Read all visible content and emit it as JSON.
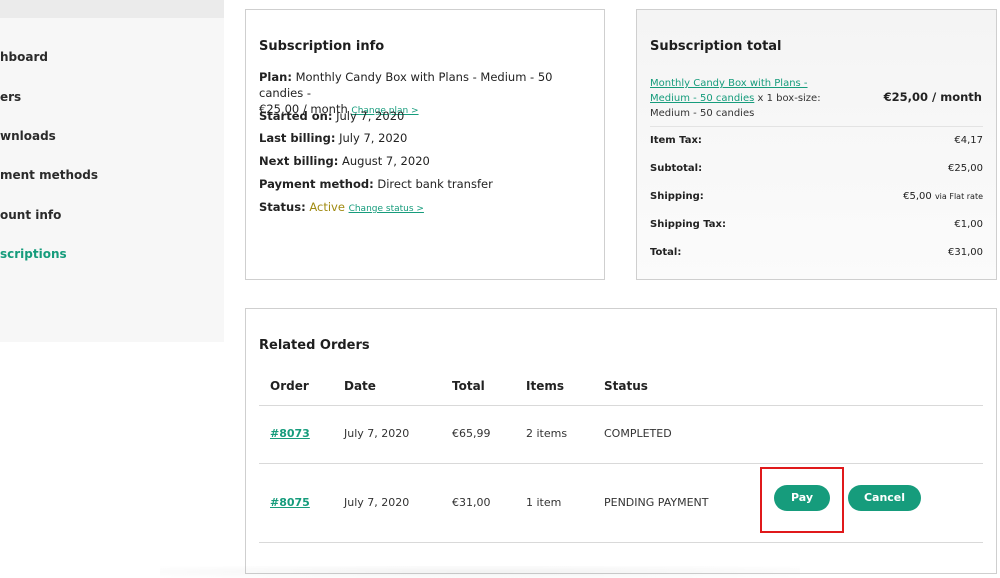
{
  "sidebar": {
    "items": [
      {
        "label": "hboard"
      },
      {
        "label": "ers"
      },
      {
        "label": "wnloads"
      },
      {
        "label": "ment methods"
      },
      {
        "label": "ount info"
      },
      {
        "label": "scriptions"
      }
    ]
  },
  "subscription_info": {
    "title": "Subscription info",
    "plan_label": "Plan:",
    "plan_value": "Monthly Candy Box with Plans - Medium - 50 candies -",
    "plan_price": "€25,00 / month",
    "change_plan": "Change plan >",
    "started_label": "Started on:",
    "started_value": "July 7, 2020",
    "last_billing_label": "Last billing:",
    "last_billing_value": "July 7, 2020",
    "next_billing_label": "Next billing:",
    "next_billing_value": "August 7, 2020",
    "payment_method_label": "Payment method:",
    "payment_method_value": "Direct bank transfer",
    "status_label": "Status:",
    "status_value": "Active",
    "change_status": "Change status >"
  },
  "subscription_total": {
    "title": "Subscription total",
    "product_link_line1": "Monthly Candy Box with Plans -",
    "product_link_line2": "Medium - 50 candies",
    "product_qty": "x 1 box-size:",
    "product_variant": "Medium - 50 candies",
    "product_price": "€25,00 / month",
    "rows": [
      {
        "label": "Item Tax:",
        "value": "€4,17"
      },
      {
        "label": "Subtotal:",
        "value": "€25,00"
      },
      {
        "label": "Shipping:",
        "value": "€5,00",
        "suffix": "via Flat rate"
      },
      {
        "label": "Shipping Tax:",
        "value": "€1,00"
      },
      {
        "label": "Total:",
        "value": "€31,00"
      }
    ]
  },
  "related_orders": {
    "title": "Related Orders",
    "headers": {
      "order": "Order",
      "date": "Date",
      "total": "Total",
      "items": "Items",
      "status": "Status"
    },
    "rows": [
      {
        "order": "#8073",
        "date": "July 7, 2020",
        "total": "€65,99",
        "items": "2 items",
        "status": "COMPLETED"
      },
      {
        "order": "#8075",
        "date": "July 7, 2020",
        "total": "€31,00",
        "items": "1 item",
        "status": "PENDING PAYMENT"
      }
    ],
    "pay_label": "Pay",
    "cancel_label": "Cancel"
  },
  "colors": {
    "accent": "#169c7c",
    "active_status": "#a08a10",
    "highlight": "#e0191b"
  }
}
